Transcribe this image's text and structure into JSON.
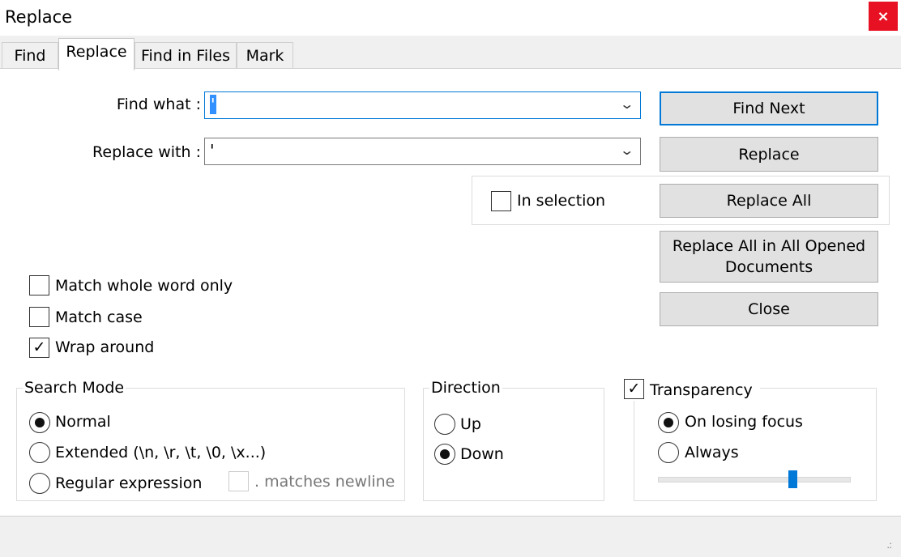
{
  "window": {
    "title": "Replace",
    "close_glyph": "×"
  },
  "tabs": [
    {
      "label": "Find"
    },
    {
      "label": "Replace",
      "active": true
    },
    {
      "label": "Find in Files"
    },
    {
      "label": "Mark"
    }
  ],
  "find": {
    "label": "Find what :",
    "value": "'"
  },
  "replace": {
    "label": "Replace with :",
    "value": "'"
  },
  "buttons": {
    "find_next": "Find Next",
    "replace": "Replace",
    "replace_all": "Replace All",
    "replace_all_opened": "Replace All in All Opened Documents",
    "close": "Close"
  },
  "in_selection": {
    "label": "In selection",
    "checked": false
  },
  "options": {
    "match_whole_word": {
      "label": "Match whole word only",
      "checked": false
    },
    "match_case": {
      "label": "Match case",
      "checked": false
    },
    "wrap_around": {
      "label": "Wrap around",
      "checked": true
    }
  },
  "search_mode": {
    "legend": "Search Mode",
    "normal": "Normal",
    "extended": "Extended (\\n, \\r, \\t, \\0, \\x...)",
    "regex": "Regular expression",
    "matches_newline": ". matches newline",
    "selected": "normal"
  },
  "direction": {
    "legend": "Direction",
    "up": "Up",
    "down": "Down",
    "selected": "down"
  },
  "transparency": {
    "legend": "Transparency",
    "checked": true,
    "on_losing_focus": "On losing focus",
    "always": "Always",
    "selected": "on_losing_focus",
    "slider_level": 0.7
  },
  "icons": {
    "check_mark": "✓",
    "chevron": "⌄",
    "close": "close-icon",
    "resize_grip": "resize-grip-icon"
  },
  "colors": {
    "accent": "#0078d7",
    "close_button": "#e81123"
  }
}
